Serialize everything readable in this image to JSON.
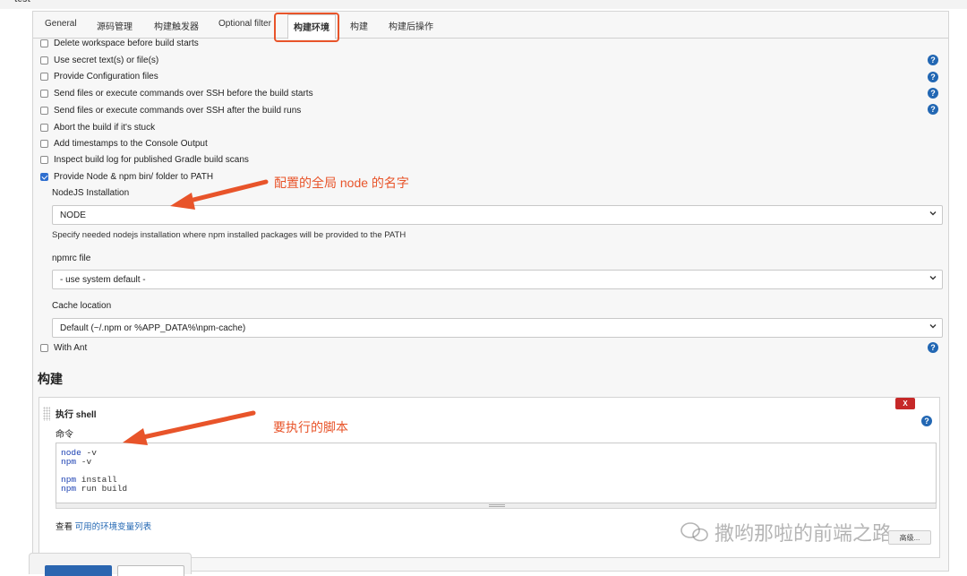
{
  "breadcrumb": {
    "job_name": "test"
  },
  "tabs": [
    {
      "label": "General"
    },
    {
      "label": "源码管理"
    },
    {
      "label": "构建触发器"
    },
    {
      "label": "Optional filter"
    },
    {
      "label": "构建环境",
      "active": true
    },
    {
      "label": "构建"
    },
    {
      "label": "构建后操作"
    }
  ],
  "build_env": {
    "options": [
      {
        "label": "Delete workspace before build starts",
        "checked": false,
        "has_help": false
      },
      {
        "label": "Use secret text(s) or file(s)",
        "checked": false,
        "has_help": true
      },
      {
        "label": "Provide Configuration files",
        "checked": false,
        "has_help": true
      },
      {
        "label": "Send files or execute commands over SSH before the build starts",
        "checked": false,
        "has_help": true
      },
      {
        "label": "Send files or execute commands over SSH after the build runs",
        "checked": false,
        "has_help": true
      },
      {
        "label": "Abort the build if it's stuck",
        "checked": false,
        "has_help": false
      },
      {
        "label": "Add timestamps to the Console Output",
        "checked": false,
        "has_help": false
      },
      {
        "label": "Inspect build log for published Gradle build scans",
        "checked": false,
        "has_help": false
      },
      {
        "label": "Provide Node & npm bin/ folder to PATH",
        "checked": true,
        "has_help": false
      }
    ],
    "nodejs_installation": {
      "label": "NodeJS Installation",
      "value": "NODE",
      "description": "Specify needed nodejs installation where npm installed packages will be provided to the PATH"
    },
    "npmrc": {
      "label": "npmrc file",
      "value": "- use system default -"
    },
    "cache": {
      "label": "Cache location",
      "value": "Default (~/.npm or %APP_DATA%\\npm-cache)"
    },
    "with_ant": {
      "label": "With Ant",
      "checked": false
    }
  },
  "build": {
    "section_title": "构建",
    "step_title": "执行 shell",
    "command_label": "命令",
    "delete_label": "X",
    "command_lines": [
      "node -v",
      "npm -v",
      "",
      "npm install",
      "npm run build"
    ],
    "env_prefix": "查看 ",
    "env_link": "可用的环境变量列表",
    "advanced_label": "高级..."
  },
  "help_glyph": "?",
  "annotations": {
    "node_name": "配置的全局 node 的名字",
    "script": "要执行的脚本"
  },
  "watermark": {
    "text": "撒哟那啦的前端之路"
  },
  "colors": {
    "accent": "#e8542a",
    "link": "#2267b3",
    "primary_button": "#2b66b0",
    "delete": "#c62828"
  }
}
